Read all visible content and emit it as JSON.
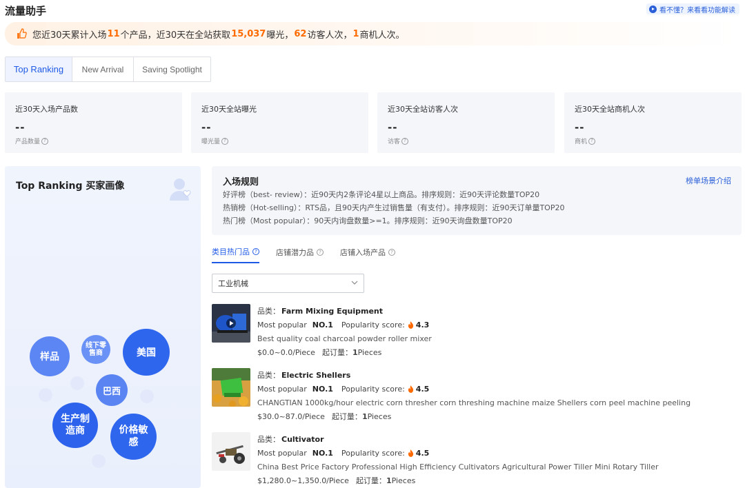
{
  "header": {
    "title": "流量助手",
    "help_link": "看不懂？来看看功能解读"
  },
  "banner": {
    "t1": "您近30天累计入场",
    "products": "11",
    "t2": "个产品，近30天在全站获取",
    "exposure": "15,037",
    "t3": "曝光，",
    "visitors": "62",
    "t4": "访客人次，",
    "merchants": "1",
    "t5": "商机人次。"
  },
  "tabs": [
    "Top Ranking",
    "New Arrival",
    "Saving Spotlight"
  ],
  "stats": [
    {
      "label": "近30天入场产品数",
      "value": "--",
      "sub": "产品数量"
    },
    {
      "label": "近30天全站曝光",
      "value": "--",
      "sub": "曝光量"
    },
    {
      "label": "近30天全站访客人次",
      "value": "--",
      "sub": "访客"
    },
    {
      "label": "近30天全站商机人次",
      "value": "--",
      "sub": "商机"
    }
  ],
  "persona": {
    "title": "Top Ranking 买家画像",
    "tags": {
      "sample": "样品",
      "offline": "线下零售商",
      "usa": "美国",
      "brazil": "巴西",
      "manufacturer": "生产制造商",
      "price": "价格敏感"
    }
  },
  "rules": {
    "title": "入场规则",
    "link": "榜单场景介绍",
    "lines": [
      "好评榜（best- review）：近90天内2条评论4星以上商品。排序规则：近90天评论数量TOP20",
      "热销榜（Hot-selling）：RTS品，且90天内产生过销售量（有支付）。排序规则：近90天订单量TOP20",
      "热门榜（Most popular）：90天内询盘数量>=1。排序规则：近90天询盘数量TOP20"
    ]
  },
  "subtabs": [
    "类目热门品",
    "店铺潜力品",
    "店铺入场产品"
  ],
  "category_select": {
    "value": "工业机械"
  },
  "labels": {
    "category": "品类：",
    "most_popular": "Most popular",
    "popularity_score": "Popularity score:",
    "moq": "起订量："
  },
  "products": [
    {
      "category": "Farm Mixing Equipment",
      "rank": "NO.1",
      "score": "4.3",
      "title": "Best quality coal charcoal powder roller mixer",
      "price": "$0.0~0.0/Piece",
      "moq_num": "1",
      "moq_unit": "Pieces"
    },
    {
      "category": "Electric Shellers",
      "rank": "NO.1",
      "score": "4.5",
      "title": "CHANGTIAN 1000kg/hour electric corn thresher corn threshing machine maize Shellers corn peel machine peeling",
      "price": "$30.0~87.0/Piece",
      "moq_num": "1",
      "moq_unit": "Pieces"
    },
    {
      "category": "Cultivator",
      "rank": "NO.1",
      "score": "4.5",
      "title": "China Best Price Factory Professional High Efficiency Cultivators Agricultural Power Tiller Mini Rotary Tiller",
      "price": "$1,280.0~1,350.0/Piece",
      "moq_num": "1",
      "moq_unit": "Pieces"
    }
  ],
  "colors": {
    "accent": "#1f5ae6",
    "highlight": "#ff6a00"
  }
}
